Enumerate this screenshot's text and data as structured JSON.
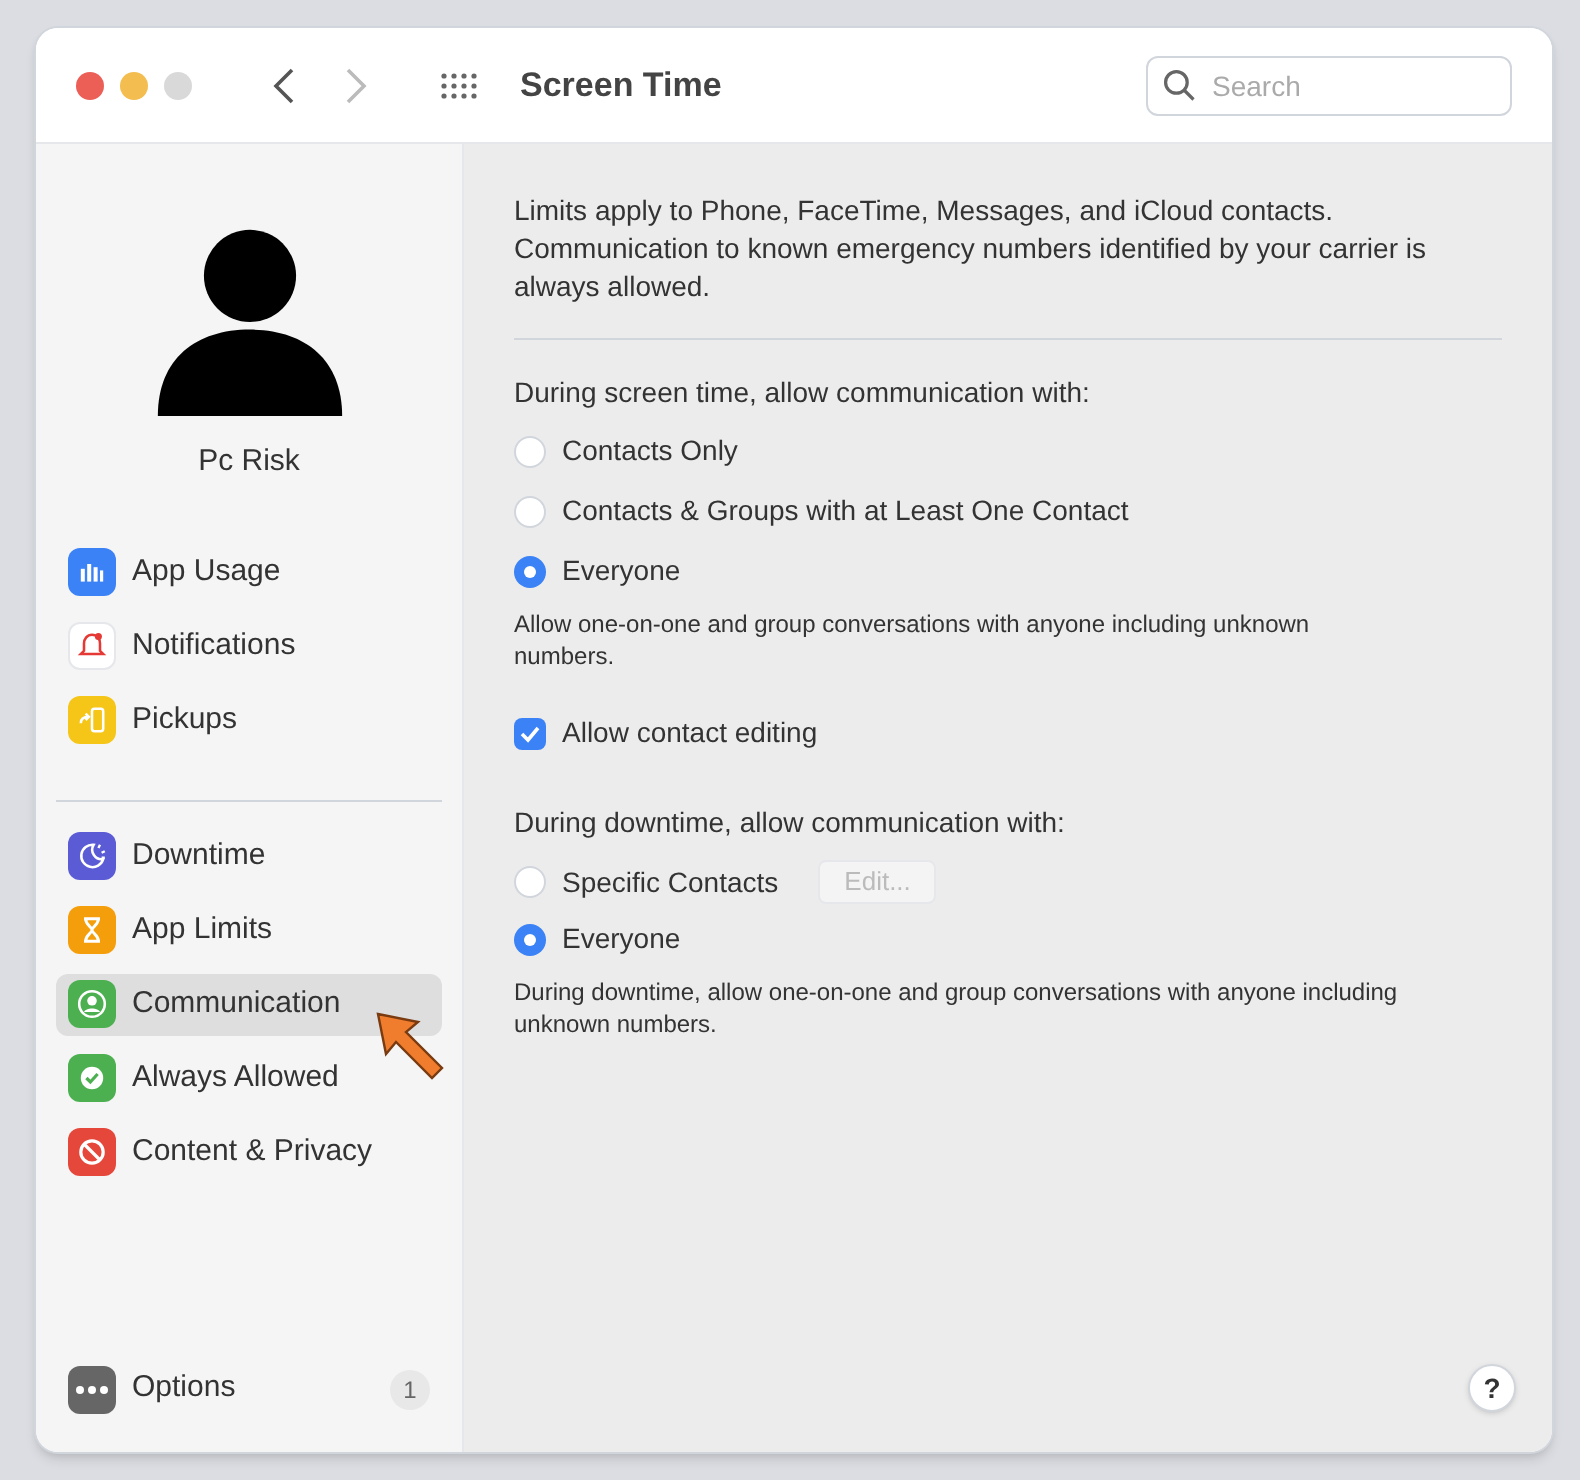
{
  "window": {
    "title": "Screen Time",
    "search": {
      "placeholder": "Search"
    }
  },
  "user": {
    "name": "Pc Risk"
  },
  "sidebar": {
    "groups": [
      [
        {
          "label": "App Usage",
          "selected": false
        },
        {
          "label": "Notifications",
          "selected": false
        },
        {
          "label": "Pickups",
          "selected": false
        }
      ],
      [
        {
          "label": "Downtime",
          "selected": false
        },
        {
          "label": "App Limits",
          "selected": false
        },
        {
          "label": "Communication",
          "selected": true
        },
        {
          "label": "Always Allowed",
          "selected": false
        },
        {
          "label": "Content & Privacy",
          "selected": false
        }
      ]
    ],
    "options": {
      "label": "Options",
      "badge": "1"
    }
  },
  "content": {
    "intro": "Limits apply to Phone, FaceTime, Messages, and iCloud contacts. Communication to known emergency numbers identified by your carrier is always allowed.",
    "screen_time": {
      "heading": "During screen time, allow communication with:",
      "options": [
        {
          "label": "Contacts Only",
          "selected": false
        },
        {
          "label": "Contacts & Groups with at Least One Contact",
          "selected": false
        },
        {
          "label": "Everyone",
          "selected": true
        }
      ],
      "note": "Allow one-on-one and group conversations with anyone including unknown numbers."
    },
    "contact_editing": {
      "label": "Allow contact editing",
      "checked": true
    },
    "downtime": {
      "heading": "During downtime, allow communication with:",
      "options": [
        {
          "label": "Specific Contacts",
          "selected": false,
          "button": "Edit..."
        },
        {
          "label": "Everyone",
          "selected": true
        }
      ],
      "note": "During downtime, allow one-on-one and group conversations with anyone including unknown numbers."
    },
    "help": "?"
  }
}
